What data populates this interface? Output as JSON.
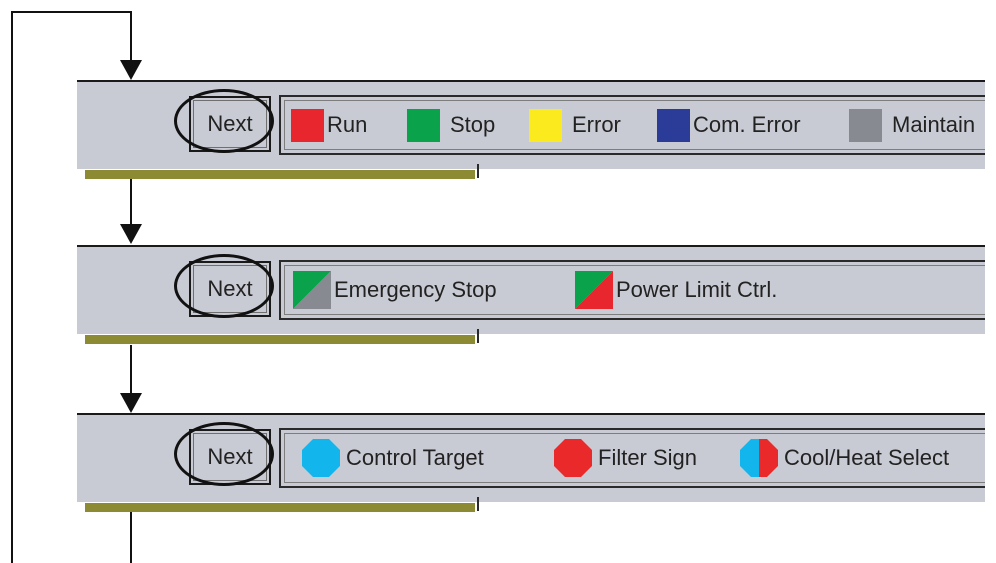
{
  "panels": [
    {
      "next_label": "Next",
      "legend": [
        {
          "label": "Run",
          "icon": "red-square-icon",
          "color": "#e8262e"
        },
        {
          "label": "Stop",
          "icon": "green-square-icon",
          "color": "#0aa24a"
        },
        {
          "label": "Error",
          "icon": "yellow-square-icon",
          "color": "#fbeb1e"
        },
        {
          "label": "Com. Error",
          "icon": "blue-square-icon",
          "color": "#2b3b98"
        },
        {
          "label": "Maintain",
          "icon": "gray-square-icon",
          "color": "#878a91"
        }
      ]
    },
    {
      "next_label": "Next",
      "legend": [
        {
          "label": "Emergency Stop",
          "icon": "green-gray-diagonal-icon",
          "colors": [
            "#0aa24a",
            "#878a91"
          ]
        },
        {
          "label": "Power Limit Ctrl.",
          "icon": "green-red-diagonal-icon",
          "colors": [
            "#0aa24a",
            "#e8262e"
          ]
        }
      ]
    },
    {
      "next_label": "Next",
      "legend": [
        {
          "label": "Control Target",
          "icon": "cyan-octagon-icon",
          "color": "#12b5ec"
        },
        {
          "label": "Filter Sign",
          "icon": "red-octagon-icon",
          "color": "#ea2a2a"
        },
        {
          "label": "Cool/Heat Select",
          "icon": "cyan-red-split-octagon-icon",
          "colors": [
            "#12b5ec",
            "#ea2a2a"
          ]
        }
      ]
    }
  ]
}
